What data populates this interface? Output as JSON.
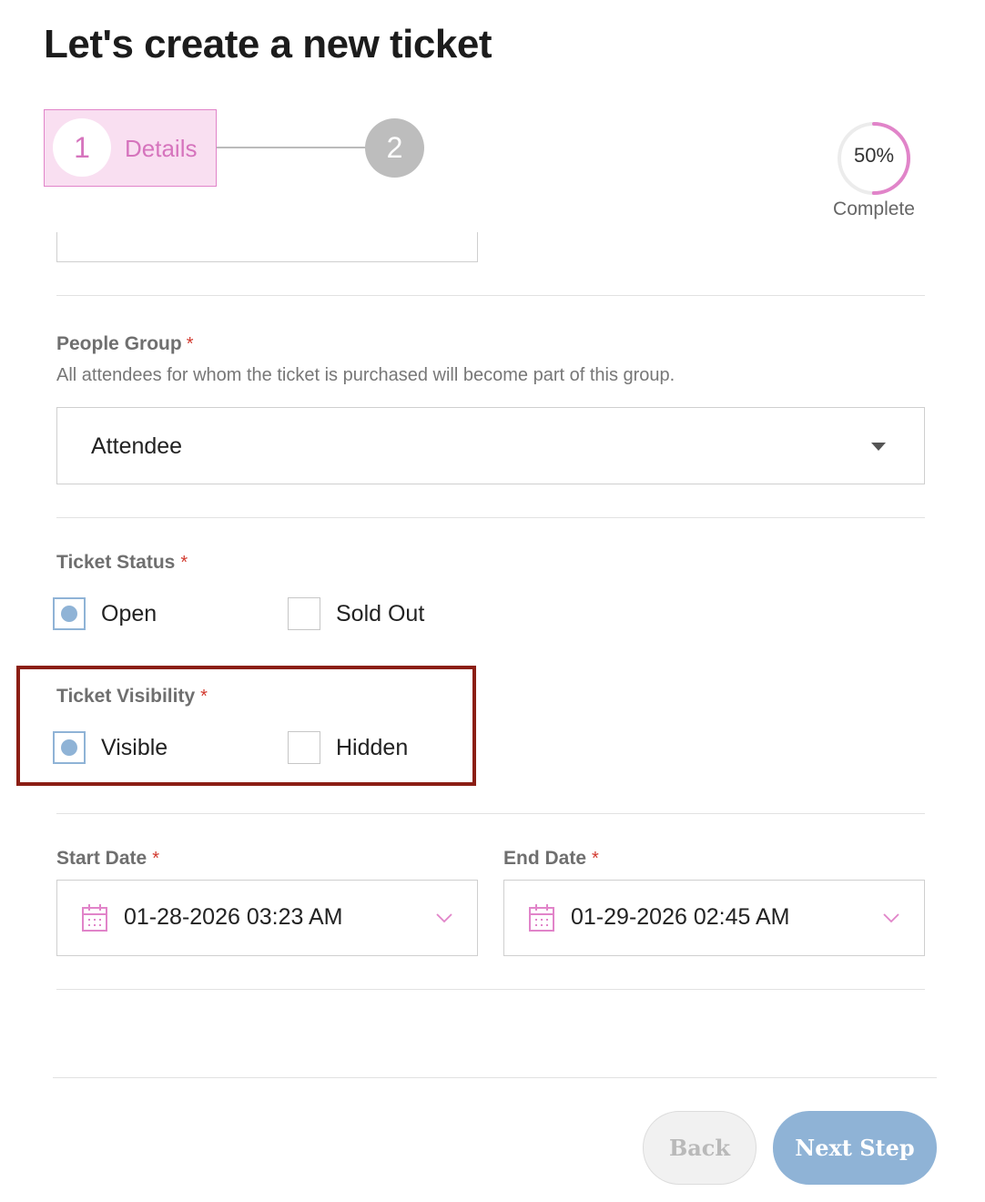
{
  "page": {
    "title": "Let's create a new ticket"
  },
  "stepper": {
    "steps": [
      {
        "number": "1",
        "label": "Details"
      },
      {
        "number": "2",
        "label": ""
      }
    ],
    "active_step": 1
  },
  "progress": {
    "value": "50%",
    "label": "Complete",
    "fraction": 0.5
  },
  "people_group": {
    "label": "People Group",
    "required_mark": "*",
    "help": "All attendees for whom the ticket is purchased will become part of this group.",
    "selected": "Attendee"
  },
  "ticket_status": {
    "label": "Ticket Status",
    "required_mark": "*",
    "options": [
      "Open",
      "Sold Out"
    ],
    "selected": "Open"
  },
  "ticket_visibility": {
    "label": "Ticket Visibility",
    "required_mark": "*",
    "options": [
      "Visible",
      "Hidden"
    ],
    "selected": "Visible"
  },
  "start_date": {
    "label": "Start Date",
    "required_mark": "*",
    "value": "01-28-2026 03:23 AM"
  },
  "end_date": {
    "label": "End Date",
    "required_mark": "*",
    "value": "01-29-2026 02:45 AM"
  },
  "buttons": {
    "back": "Back",
    "next": "Next Step"
  },
  "colors": {
    "accent_pink": "#d674bd",
    "accent_blue": "#8fb3d6",
    "highlight": "#8b1e14",
    "required": "#d23a2f"
  },
  "icons": {
    "dropdown": "caret-down-icon",
    "calendar": "calendar-icon",
    "date_dropdown": "chevron-down-icon"
  }
}
